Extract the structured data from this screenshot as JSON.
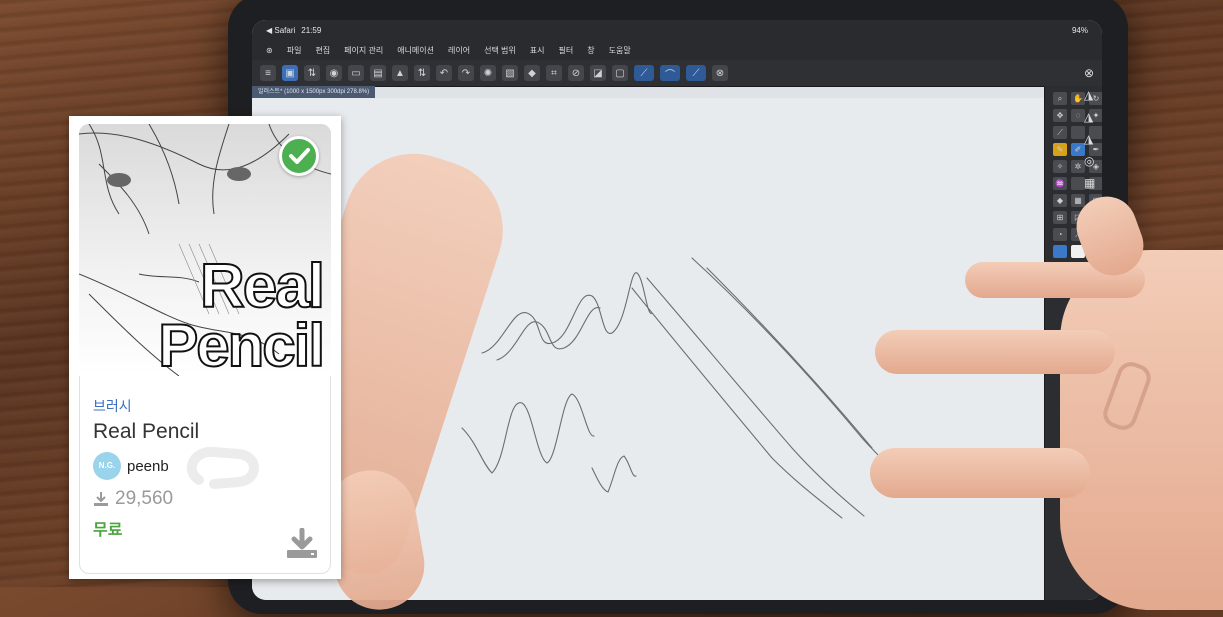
{
  "status_bar": {
    "back_app": "◀ Safari",
    "time": "21:59",
    "battery": "94%"
  },
  "menu": [
    "파일",
    "편집",
    "페이지 관리",
    "애니메이션",
    "레이어",
    "선택 범위",
    "표시",
    "필터",
    "창",
    "도움말"
  ],
  "document_tab": "일러스트* (1000 x 1500px 300dpi 278.8%)",
  "card": {
    "thumbnail_title_line1": "Real",
    "thumbnail_title_line2": "Pencil",
    "category": "브러시",
    "name": "Real Pencil",
    "author_avatar": "N.G.",
    "author": "peenb",
    "downloads": "29,560",
    "price": "무료"
  },
  "colors": {
    "accent": "#3b6fc4",
    "price": "#4aa53e",
    "check": "#4caf50"
  }
}
